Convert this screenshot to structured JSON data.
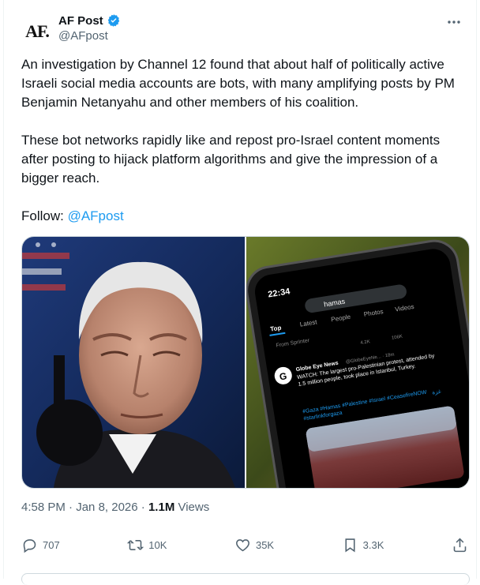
{
  "author": {
    "avatar_text": "AF.",
    "name": "AF Post",
    "handle": "@AFpost"
  },
  "post": {
    "paragraph1": "An investigation by Channel 12 found that about half of politically active Israeli social media accounts are bots, with many amplifying posts by PM Benjamin Netanyahu and other members of his coalition.",
    "paragraph2": "These bot networks rapidly like and repost pro-Israel content moments after posting to hijack platform algorithms and give the impression of a bigger reach.",
    "follow_prefix": "Follow: ",
    "follow_link": "@AFpost"
  },
  "phone_screen": {
    "time": "22:34",
    "search": "hamas",
    "tabs": [
      "Top",
      "Latest",
      "People",
      "Photos",
      "Videos"
    ],
    "from_line": "From Sprinter",
    "account": "Globe Eye News",
    "account_handle": "@GlobeEyeNe... · 18m",
    "text": "WATCH: The largest pro-Palestinian protest, attended by 1.5 million people, took place in Istanbul, Turkey.",
    "hashtags": "#Gaza #Hamas #Palestine #Israel #CeasefireNOW #starlinkforgaza",
    "arabic": "غزة",
    "stat1": "4.2K",
    "stat2": "106K"
  },
  "meta": {
    "time": "4:58 PM",
    "sep1": " · ",
    "date": "Jan 8, 2026",
    "sep2": " · ",
    "views_count": "1.1M",
    "views_label": " Views"
  },
  "actions": {
    "replies": "707",
    "reposts": "10K",
    "likes": "35K",
    "bookmarks": "3.3K"
  },
  "colors": {
    "accent": "#1d9bf0",
    "secondary_text": "#536471",
    "verified": "#1d9bf0"
  }
}
